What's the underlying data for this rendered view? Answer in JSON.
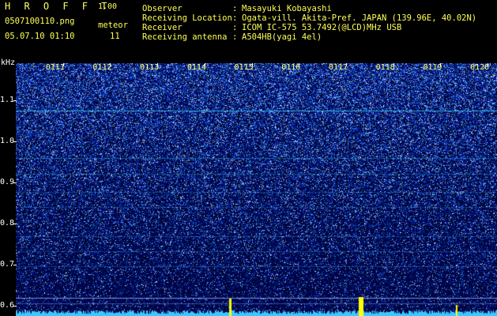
{
  "header": {
    "app_title": "H R O F F T",
    "version": "1.00",
    "filename": "0507100110.png",
    "datetime": "05.07.10 01:10",
    "meteor_label": "meteor",
    "meteor_count": "11",
    "info": [
      {
        "label": "Observer",
        "sep": ":",
        "value": "Masayuki Kobayashi"
      },
      {
        "label": "Receiving Location",
        "sep": ":",
        "value": "Ogata-vill. Akita-Pref. JAPAN (139.96E, 40.02N)"
      },
      {
        "label": "Receiver",
        "sep": ":",
        "value": "ICOM IC-575 53.7492(@LCD)MHz USB"
      },
      {
        "label": "Receiving antenna",
        "sep": ":",
        "value": "A504HB(yagi 4el)"
      }
    ]
  },
  "spectrogram": {
    "y_unit": "kHz",
    "y_ticks": [
      "1.1",
      "1.0",
      "0.9",
      "0.8",
      "0.7",
      "0.6"
    ],
    "y_values": [
      1.1,
      1.0,
      0.9,
      0.8,
      0.7,
      0.6
    ],
    "y_range": [
      0.575,
      1.19
    ],
    "x_ticks": [
      "0111",
      "0112",
      "0113",
      "0114",
      "0115",
      "0116",
      "0117",
      "0118",
      "0119",
      "0120"
    ],
    "x_values": [
      1,
      2,
      3,
      4,
      5,
      6,
      7,
      8,
      9,
      10
    ],
    "x_range": [
      0,
      10.2
    ],
    "colors": {
      "noise_dark": "#000a3a",
      "noise_mid": "#1428c8",
      "noise_bright": "#7fd7ff",
      "signal": "#3cc8ff",
      "text": "#ffff55",
      "meteor": "#ffff00"
    }
  }
}
